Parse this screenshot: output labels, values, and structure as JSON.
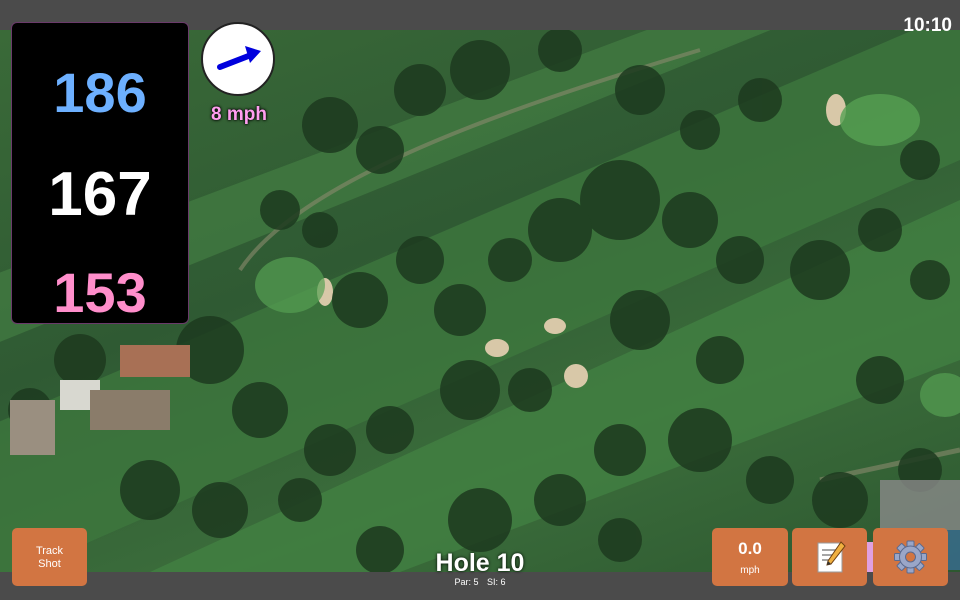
{
  "status_bar": {
    "time": "10:10"
  },
  "distances": {
    "back": "186",
    "middle": "167",
    "front": "153"
  },
  "wind": {
    "speed_label": "8 mph",
    "direction": "east-northeast"
  },
  "hole": {
    "title": "Hole 10",
    "par": "Par: 5",
    "si": "SI: 6"
  },
  "buttons": {
    "track_shot_line1": "Track",
    "track_shot_line2": "Shot",
    "wind_value": "0.0",
    "wind_unit": "mph",
    "notes_icon": "memo-icon",
    "settings_icon": "gear-icon"
  },
  "colors": {
    "back_distance": "#6db0ff",
    "middle_distance": "#ffffff",
    "front_distance": "#ff8ecb",
    "button_orange": "#d27542",
    "wind_text": "#ff9ef0",
    "wind_arrow": "#0000dd"
  }
}
